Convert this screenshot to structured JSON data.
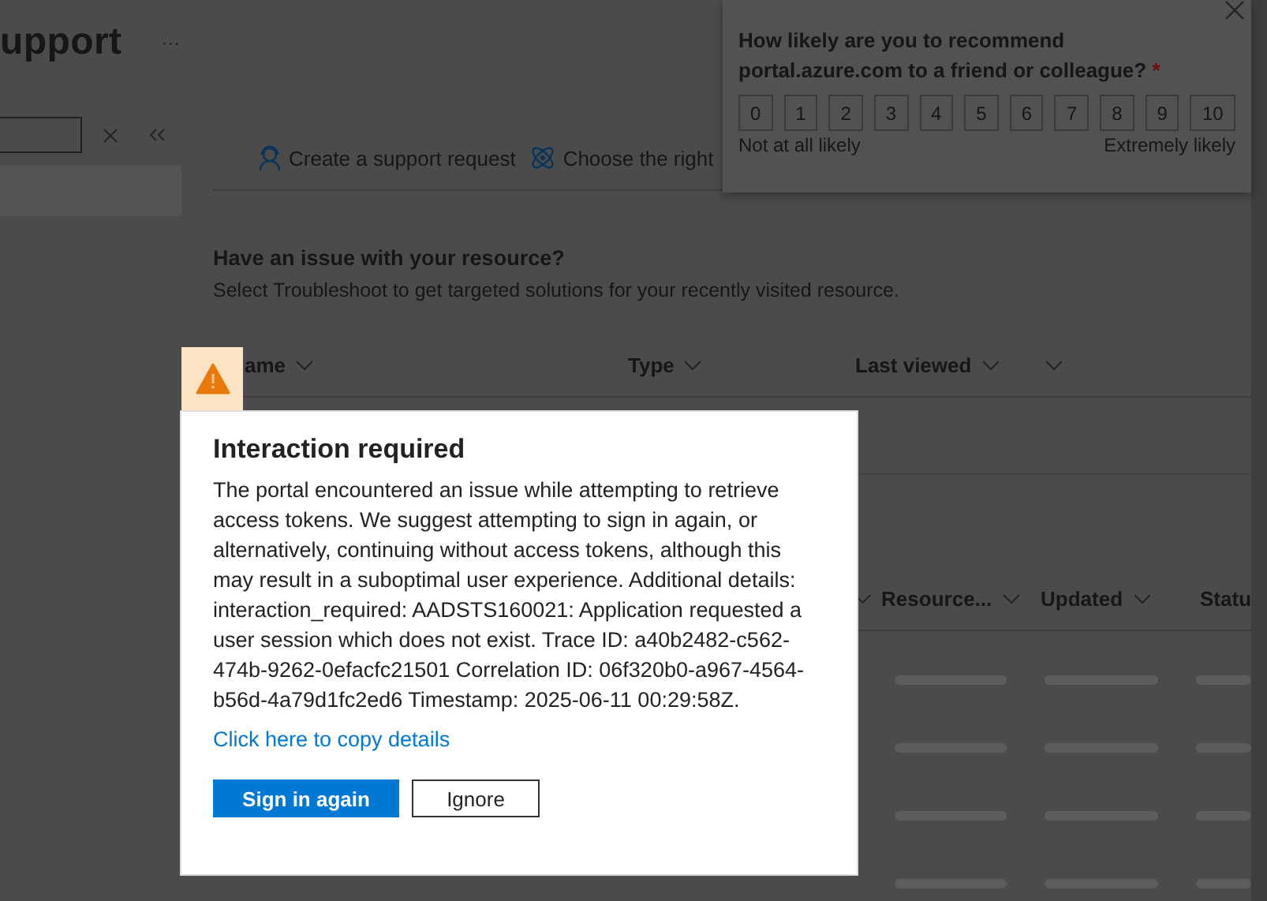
{
  "page": {
    "title": "upport",
    "more": "···"
  },
  "sidebar": {
    "items": [
      {
        "selected": true
      }
    ]
  },
  "toolbar": [
    {
      "label": "Create a support request"
    },
    {
      "label": "Choose the right"
    }
  ],
  "resource_section": {
    "heading": "Have an issue with your resource?",
    "description": "Select Troubleshoot to get targeted solutions for your recently visited resource.",
    "columns": [
      "ame",
      "Type",
      "Last viewed",
      ""
    ]
  },
  "requests_table": {
    "columns": [
      "Resource...",
      "Updated",
      "Statu"
    ]
  },
  "survey": {
    "question": "How likely are you to recommend portal.azure.com to a friend or colleague?",
    "required_mark": "*",
    "scale": [
      "0",
      "1",
      "2",
      "3",
      "4",
      "5",
      "6",
      "7",
      "8",
      "9",
      "10"
    ],
    "low_label": "Not at all likely",
    "high_label": "Extremely likely"
  },
  "dialog": {
    "title": "Interaction required",
    "message": "The portal encountered an issue while attempting to retrieve access tokens. We suggest attempting to sign in again, or alternatively, continuing without access tokens, although this may result in a suboptimal user experience. Additional details: interaction_required: AADSTS160021: Application requested a user session which does not exist. Trace ID: a40b2482-c562-474b-9262-0efacfc21501 Correlation ID: 06f320b0-a967-4564-b56d-4a79d1fc2ed6 Timestamp: 2025-06-11 00:29:58Z.",
    "link": "Click here to copy details",
    "buttons": [
      {
        "label": "Sign in again",
        "kind": "primary"
      },
      {
        "label": "Ignore",
        "kind": "secondary"
      }
    ]
  }
}
